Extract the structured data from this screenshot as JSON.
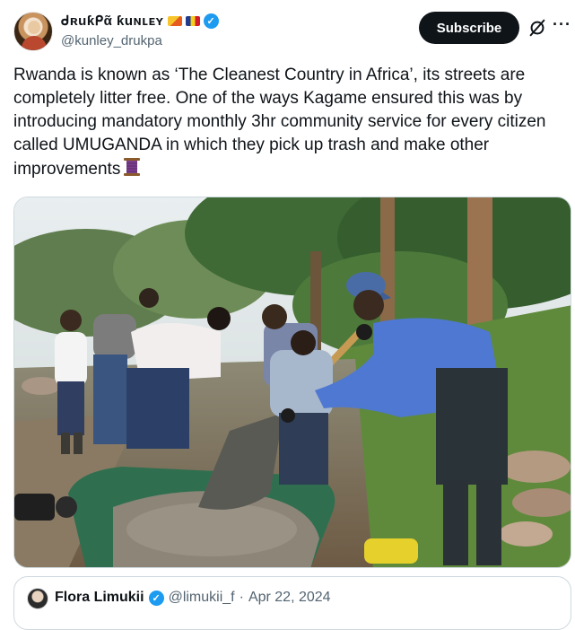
{
  "author": {
    "display_name": "ᑯʀuƙᑭᾶ ƙuɴʟᴇʏ",
    "handle": "@kunley_drukpa",
    "verified_mark": "✓",
    "flags": [
      "bhutan-flag",
      "chad-flag"
    ]
  },
  "actions": {
    "subscribe_label": "Subscribe",
    "more_label": "···"
  },
  "tweet": {
    "text": "Rwanda is known as ‘The Cleanest Country in Africa’, its streets are completely litter free. One of the ways Kagame ensured this was by introducing mandatory monthly 3hr community service for every citizen called UMUGANDA in which they pick up trash and make other improvements",
    "emoji_icon": "thread-spool-icon"
  },
  "quote": {
    "display_name": "Flora Limukii",
    "verified_mark": "✓",
    "handle": "@limukii_f",
    "separator": "·",
    "date": "Apr 22, 2024"
  },
  "colors": {
    "verified_blue": "#1d9bf0",
    "text": "#0f1419",
    "muted": "#536471",
    "border": "#cfd9de",
    "subscribe_bg": "#0f1419"
  }
}
